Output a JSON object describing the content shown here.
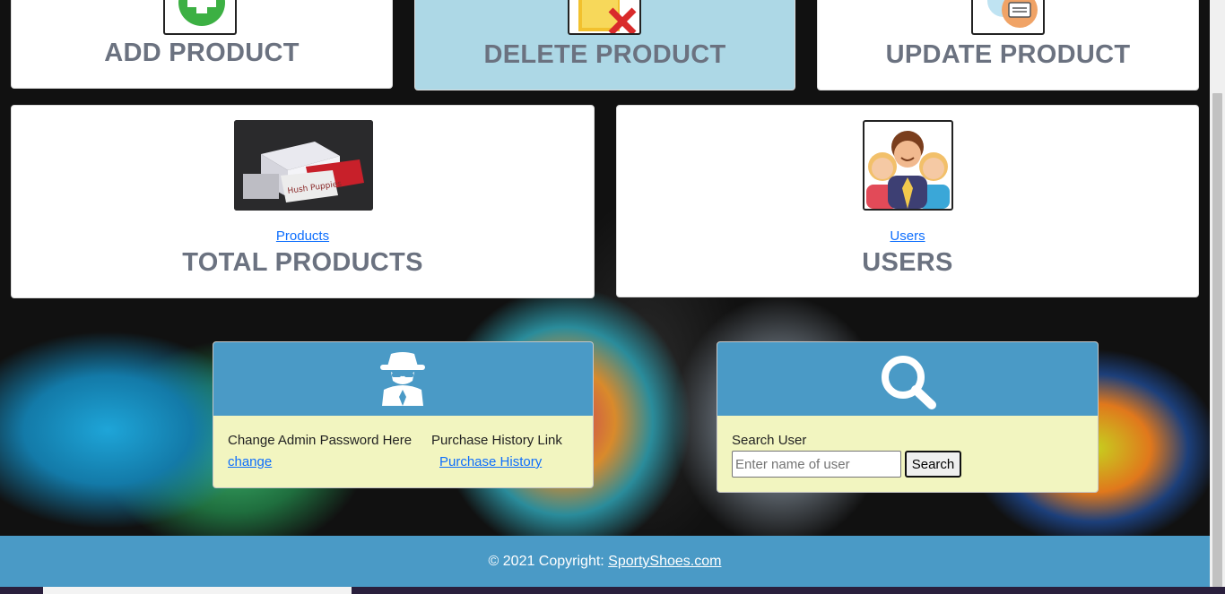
{
  "cards": {
    "add": {
      "title": "ADD PRODUCT",
      "icon": "add-plus-icon"
    },
    "delete": {
      "title": "DELETE PRODUCT",
      "icon": "delete-folder-icon"
    },
    "update": {
      "title": "UPDATE PRODUCT",
      "icon": "update-document-icon"
    },
    "products": {
      "link": "Products",
      "title": "TOTAL PRODUCTS",
      "image": "shoe-boxes-image"
    },
    "users": {
      "link": "Users",
      "title": "USERS",
      "image": "users-group-image"
    }
  },
  "admin_panel": {
    "icon": "spy-agent-icon",
    "change_text": "Change Admin Password Here",
    "change_link": "change",
    "history_text": "Purchase History Link",
    "history_link": "Purchase History"
  },
  "search_panel": {
    "icon": "search-icon",
    "label": "Search User",
    "placeholder": "Enter name of user",
    "button": "Search"
  },
  "footer": {
    "text": "© 2021 Copyright: ",
    "link": "SportyShoes.com"
  },
  "colors": {
    "panel_header": "#4a9ac6",
    "panel_body": "#f2f5c0",
    "active_card": "#add8e6",
    "title_gray": "#6b7280",
    "link_blue": "#0d6efd"
  }
}
